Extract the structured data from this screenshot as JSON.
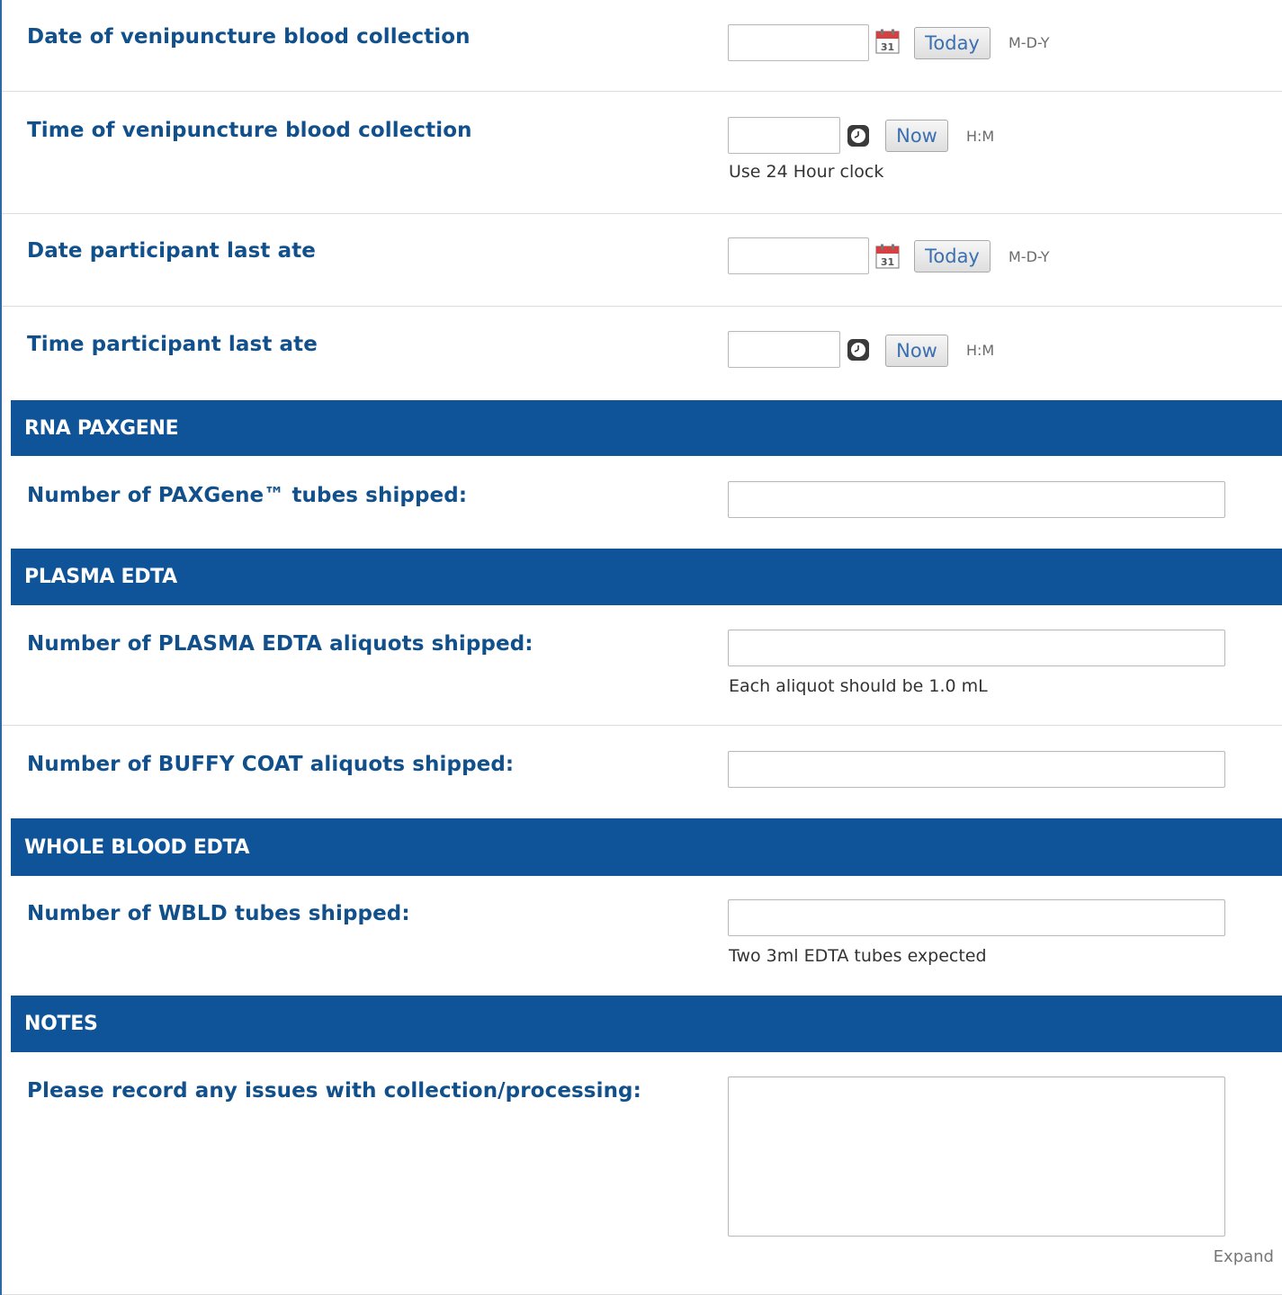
{
  "fields": {
    "venipuncture_date": {
      "label": "Date of venipuncture blood collection",
      "button": "Today",
      "format": "M-D-Y"
    },
    "venipuncture_time": {
      "label": "Time of venipuncture blood collection",
      "button": "Now",
      "format": "H:M",
      "note": "Use 24 Hour clock"
    },
    "last_ate_date": {
      "label": "Date participant last ate",
      "button": "Today",
      "format": "M-D-Y"
    },
    "last_ate_time": {
      "label": "Time participant last ate",
      "button": "Now",
      "format": "H:M"
    }
  },
  "sections": {
    "rna_paxgene": {
      "title": "RNA PAXGENE",
      "paxgene_tubes_label": "Number of PAXGene™ tubes shipped:"
    },
    "plasma_edta": {
      "title": "PLASMA EDTA",
      "plasma_aliquots_label": "Number of PLASMA EDTA aliquots shipped:",
      "plasma_aliquots_note": "Each aliquot should be 1.0 mL",
      "buffy_coat_label": "Number of BUFFY COAT aliquots shipped:"
    },
    "whole_blood_edta": {
      "title": "WHOLE BLOOD EDTA",
      "wbld_label": "Number of WBLD tubes shipped:",
      "wbld_note": "Two 3ml EDTA tubes expected"
    },
    "notes": {
      "title": "NOTES",
      "issues_label": "Please record any issues with collection/processing:",
      "expand_link": "Expand"
    }
  },
  "icons": {
    "calendar": "calendar-icon",
    "clock": "clock-icon"
  },
  "colors": {
    "label": "#12508c",
    "header_bg": "#0f5499",
    "header_text": "#ffffff",
    "button_text": "#3a6fb0"
  }
}
